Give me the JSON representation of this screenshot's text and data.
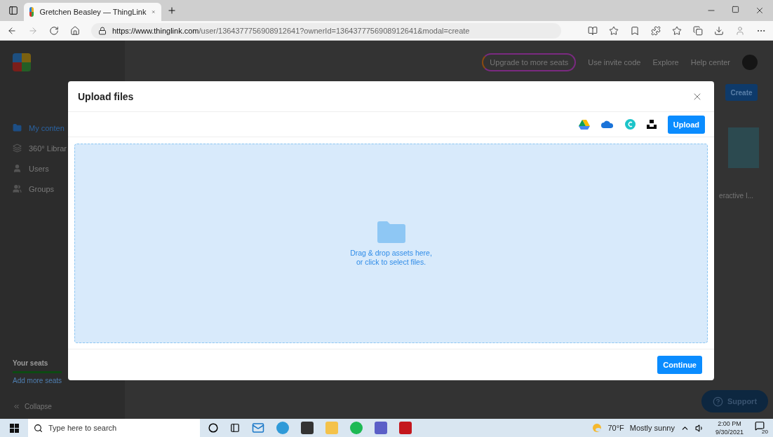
{
  "browser": {
    "tab_title": "Gretchen Beasley — ThingLink",
    "url_host": "https://www.thinglink.com",
    "url_path": "/user/1364377756908912641?ownerId=1364377756908912641&modal=create"
  },
  "app": {
    "nav": [
      {
        "label": "Upgrade to more seats",
        "kind": "pill"
      },
      {
        "label": "Use invite code",
        "kind": "link"
      },
      {
        "label": "Explore",
        "kind": "link"
      },
      {
        "label": "Help center",
        "kind": "link"
      }
    ],
    "create_button": "Create",
    "sidebar": {
      "items": [
        {
          "label": "My conten",
          "selected": true
        },
        {
          "label": "360° Librar",
          "selected": false
        },
        {
          "label": "Users",
          "selected": false
        },
        {
          "label": "Groups",
          "selected": false
        }
      ],
      "seats_title": "Your seats",
      "seats_link": "Add more seats",
      "collapse": "Collapse"
    },
    "card_title": "eractive I...",
    "support": "Support"
  },
  "modal": {
    "title": "Upload files",
    "upload_button": "Upload",
    "dropzone_lines": [
      "Drag & drop assets here,",
      "or click to select files."
    ],
    "continue_button": "Continue"
  },
  "taskbar": {
    "search_placeholder": "Type here to search",
    "temperature": "70°F",
    "weather": "Mostly sunny",
    "time": "2:00 PM",
    "date": "9/30/2021",
    "notifications": "20"
  }
}
